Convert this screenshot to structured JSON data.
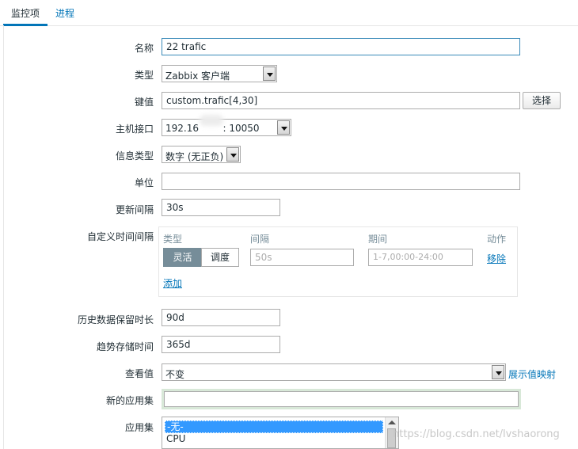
{
  "tabs": [
    {
      "label": "监控项",
      "active": true
    },
    {
      "label": "进程",
      "active": false
    }
  ],
  "fields": {
    "name": {
      "label": "名称",
      "value": "22 trafic"
    },
    "type": {
      "label": "类型",
      "value": "Zabbix 客户端"
    },
    "key": {
      "label": "键值",
      "value": "custom.trafic[4,30]",
      "button": "选择"
    },
    "interface": {
      "label": "主机接口",
      "value": "192.16        : 10050"
    },
    "info_type": {
      "label": "信息类型",
      "value": "数字 (无正负)"
    },
    "units": {
      "label": "单位",
      "value": ""
    },
    "update_interval": {
      "label": "更新间隔",
      "value": "30s"
    },
    "custom_intervals": {
      "label": "自定义时间间隔",
      "headers": {
        "type": "类型",
        "interval": "间隔",
        "period": "期间",
        "action": "动作"
      },
      "type_options": [
        "灵活",
        "调度"
      ],
      "interval_placeholder": "50s",
      "period_placeholder": "1-7,00:00-24:00",
      "remove": "移除",
      "add": "添加"
    },
    "history": {
      "label": "历史数据保留时长",
      "value": "90d"
    },
    "trends": {
      "label": "趋势存储时间",
      "value": "365d"
    },
    "show_value": {
      "label": "查看值",
      "value": "不变",
      "link": "展示值映射"
    },
    "new_application": {
      "label": "新的应用集",
      "value": ""
    },
    "applications": {
      "label": "应用集",
      "options": [
        "-无-",
        "CPU"
      ]
    }
  },
  "watermark": "https://blog.csdn.net/lvshaorong",
  "colors": {
    "accent": "#0275b8",
    "segment_on": "#768d99",
    "list_selected": "#3399ff"
  }
}
